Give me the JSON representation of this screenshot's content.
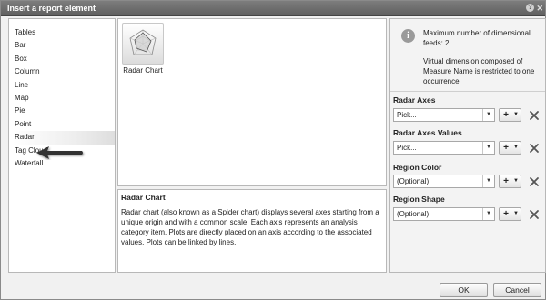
{
  "dialog": {
    "title": "Insert a report element",
    "help_glyph": "?",
    "close_glyph": "✕"
  },
  "element_types": [
    {
      "label": "Tables"
    },
    {
      "label": "Bar"
    },
    {
      "label": "Box"
    },
    {
      "label": "Column"
    },
    {
      "label": "Line"
    },
    {
      "label": "Map"
    },
    {
      "label": "Pie"
    },
    {
      "label": "Point"
    },
    {
      "label": "Radar",
      "selected": true
    },
    {
      "label": "Tag Cloud"
    },
    {
      "label": "Waterfall"
    }
  ],
  "charts": [
    {
      "label": "Radar Chart",
      "icon": "radar-chart-icon"
    }
  ],
  "description": {
    "title": "Radar Chart",
    "text": "Radar chart (also known as a Spider chart) displays several axes starting from a unique origin and with a common scale. Each axis represents an analysis category item. Plots are directly placed on an axis according to the associated values. Plots can be linked by lines."
  },
  "info": {
    "icon": "info-icon",
    "line1": "Maximum number of dimensional feeds: 2",
    "line2": "Virtual dimension composed of Measure Name is restricted to one occurrence"
  },
  "fields": [
    {
      "label": "Radar Axes",
      "value": "Pick..."
    },
    {
      "label": "Radar Axes Values",
      "value": "Pick..."
    },
    {
      "label": "Region Color",
      "value": "(Optional)"
    },
    {
      "label": "Region Shape",
      "value": "(Optional)"
    }
  ],
  "buttons": {
    "ok": "OK",
    "cancel": "Cancel"
  }
}
